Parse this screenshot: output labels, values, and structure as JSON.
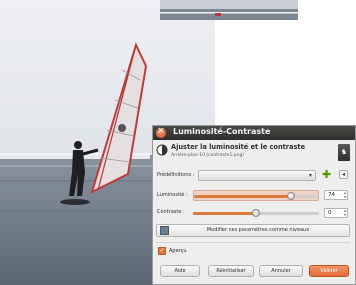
{
  "dialog": {
    "title": "Luminosité-Contraste",
    "header_main": "Ajuster la luminosité et le contraste",
    "header_sub": "Arrière-plan-10 (contraste1.png)",
    "corner_icon": "gimp-icon"
  },
  "presets": {
    "label": "Prédéfinitions :",
    "value": "",
    "add_icon": "plus-icon",
    "menu_icon": "menu-icon"
  },
  "brightness": {
    "label": "Luminosité :",
    "value": "74",
    "fraction": 0.78
  },
  "contrast": {
    "label": "Contraste :",
    "value": "0",
    "fraction": 0.5
  },
  "apply_button": {
    "label": "Modifier ces paramètres comme niveaux"
  },
  "preview": {
    "label": "Aperçu",
    "checked": true
  },
  "buttons": {
    "help": "Aide",
    "reset": "Réinitialiser",
    "cancel": "Annuler",
    "ok": "Valider"
  },
  "colors": {
    "accent": "#e07a3a",
    "titlebar": "#3a3a38",
    "dialog_bg": "#eeeeec"
  }
}
